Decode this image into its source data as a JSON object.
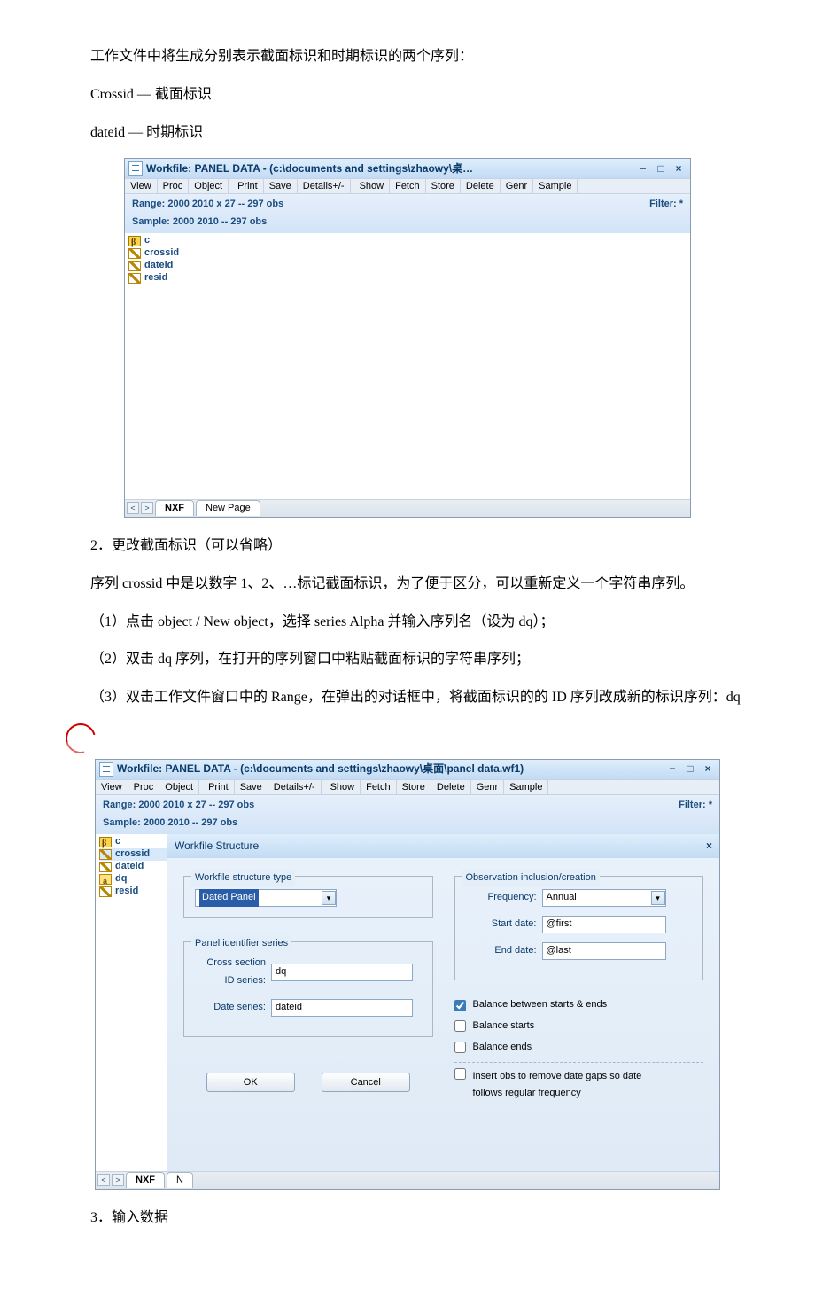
{
  "text": {
    "p1": "工作文件中将生成分别表示截面标识和时期标识的两个序列：",
    "p2": "Crossid — 截面标识",
    "p3": "dateid — 时期标识",
    "p4": "2．更改截面标识（可以省略）",
    "p5": "序列 crossid 中是以数字 1、2、…标记截面标识，为了便于区分，可以重新定义一个字符串序列。",
    "p6": "（1）点击 object / New object，选择 series Alpha 并输入序列名（设为 dq）；",
    "p7": "（2）双击 dq 序列，在打开的序列窗口中粘贴截面标识的字符串序列；",
    "p8": "（3）双击工作文件窗口中的 Range，在弹出的对话框中，将截面标识的的 ID 序列改成新的标识序列：dq",
    "p9": "3．输入数据"
  },
  "toolbar": {
    "items": [
      "View",
      "Proc",
      "Object",
      "Print",
      "Save",
      "Details+/-",
      "Show",
      "Fetch",
      "Store",
      "Delete",
      "Genr",
      "Sample"
    ]
  },
  "wincontrols": {
    "min": "−",
    "max": "□",
    "close": "×"
  },
  "wf1": {
    "title": "Workfile: PANEL DATA - (c:\\documents and settings\\zhaowy\\桌…",
    "range": "Range:  2000 2010 x 27   --   297 obs",
    "sample": "Sample: 2000 2010   --   297 obs",
    "filter": "Filter: *",
    "objects": {
      "c": "c",
      "crossid": "crossid",
      "dateid": "dateid",
      "resid": "resid"
    },
    "tabs": {
      "active": "NXF",
      "new": "New Page"
    },
    "nav": {
      "prev": "<",
      "next": ">"
    }
  },
  "wf2": {
    "title": "Workfile: PANEL DATA - (c:\\documents and settings\\zhaowy\\桌面\\panel data.wf1)",
    "range": "Range:  2000 2010 x 27   --   297 obs",
    "sample": "Sample: 2000 2010   --   297 obs",
    "filter": "Filter: *",
    "objects": {
      "c": "c",
      "crossid": "crossid",
      "dateid": "dateid",
      "dq": "dq",
      "resid": "resid"
    },
    "tabs": {
      "active": "NXF",
      "new": "N"
    },
    "nav": {
      "prev": "<",
      "next": ">"
    }
  },
  "structure": {
    "title": "Workfile Structure",
    "group_type": "Workfile structure type",
    "type_value": "Dated Panel",
    "group_ids": "Panel identifier series",
    "cross_label": "Cross section ID series:",
    "cross_value": "dq",
    "date_label": "Date series:",
    "date_value": "dateid",
    "group_obs": "Observation inclusion/creation",
    "freq_label": "Frequency:",
    "freq_value": "Annual",
    "start_label": "Start date:",
    "start_value": "@first",
    "end_label": "End date:",
    "end_value": "@last",
    "chk1": "Balance between starts & ends",
    "chk2": "Balance starts",
    "chk3": "Balance ends",
    "chk4": "Insert obs to remove date gaps so date follows regular frequency",
    "ok": "OK",
    "cancel": "Cancel",
    "close": "×"
  }
}
